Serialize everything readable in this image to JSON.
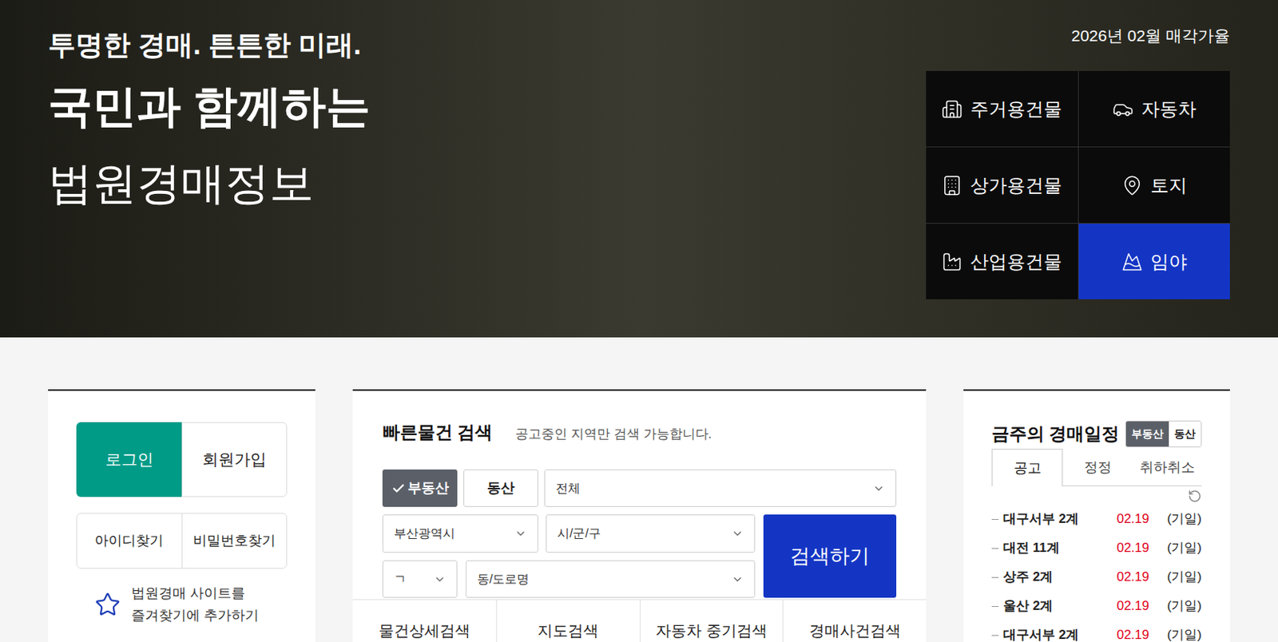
{
  "hero": {
    "slogan": "투명한 경매. 튼튼한 미래.",
    "headline": "국민과 함께하는",
    "title": "법원경매정보",
    "rate_caption": "2026년 02월 매각가율"
  },
  "categories": [
    {
      "label": "주거용건물",
      "selected": false
    },
    {
      "label": "자동차",
      "selected": false
    },
    {
      "label": "상가용건물",
      "selected": false
    },
    {
      "label": "토지",
      "selected": false
    },
    {
      "label": "산업용건물",
      "selected": false
    },
    {
      "label": "임야",
      "selected": true
    }
  ],
  "login_panel": {
    "login_button": "로그인",
    "signup_button": "회원가입",
    "find_id": "아이디찾기",
    "find_password": "비밀번호찾기",
    "favorite_lines": [
      "법원경매 사이트를",
      "즐겨찾기에 추가하기"
    ]
  },
  "quick_search": {
    "title": "빠른물건 검색",
    "subtitle": "공고중인 지역만 검색 가능합니다.",
    "types": [
      {
        "label": "부동산",
        "selected": true
      },
      {
        "label": "동산",
        "selected": false
      }
    ],
    "category_select": "전체",
    "sido_select": "부산광역시",
    "sigungu_select": "시/군/구",
    "initial_select": "ㄱ",
    "dong_select": "동/도로명",
    "search_button": "검색하기",
    "tabs": [
      "물건상세검색",
      "지도검색",
      "자동차 중기검색",
      "경매사건검색"
    ]
  },
  "schedule": {
    "title": "금주의 경매일정",
    "toggle": [
      {
        "label": "부동산",
        "selected": true
      },
      {
        "label": "동산",
        "selected": false
      }
    ],
    "tabs": [
      {
        "label": "공고",
        "selected": true
      },
      {
        "label": "정정",
        "selected": false
      },
      {
        "label": "취하취소",
        "selected": false
      }
    ],
    "items": [
      {
        "court": "대구서부 2계",
        "date": "02.19",
        "type": "(기일)"
      },
      {
        "court": "대전 11계",
        "date": "02.19",
        "type": "(기일)"
      },
      {
        "court": "상주 2계",
        "date": "02.19",
        "type": "(기일)"
      },
      {
        "court": "울산 2계",
        "date": "02.19",
        "type": "(기일)"
      },
      {
        "court": "대구서부 2계",
        "date": "02.19",
        "type": "(기일)"
      }
    ]
  }
}
